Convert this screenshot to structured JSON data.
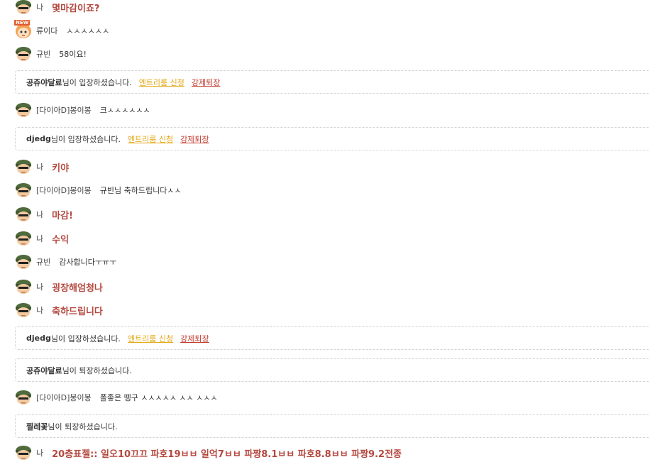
{
  "messages": [
    {
      "type": "chat",
      "me": true,
      "avatar": "soldier",
      "nick": "나",
      "text": "몇마감이죠?"
    },
    {
      "type": "chat",
      "me": false,
      "avatar": "new-character",
      "nick": "류이다",
      "text": "ㅅㅅㅅㅅㅅㅅ",
      "badge": "NEW"
    },
    {
      "type": "chat",
      "me": false,
      "avatar": "soldier",
      "nick": "규빈",
      "text": "58이요!"
    },
    {
      "type": "system",
      "user": "공쥬야달료",
      "suffix": "님이 입장하셨습니다.",
      "entry": "엔트리룸 신청",
      "kick": "강제퇴장"
    },
    {
      "type": "chat",
      "me": false,
      "avatar": "soldier",
      "nick": "[다이아D]봉이봉",
      "text": "크ㅅㅅㅅㅅㅅㅅ"
    },
    {
      "type": "system",
      "user": "djedg",
      "suffix": "님이 입장하셨습니다.",
      "entry": "엔트리룸 신청",
      "kick": "강제퇴장"
    },
    {
      "type": "chat",
      "me": true,
      "avatar": "soldier",
      "nick": "나",
      "text": "키야"
    },
    {
      "type": "chat",
      "me": false,
      "avatar": "soldier",
      "nick": "[다이아D]봉이봉",
      "text": "규빈님 축하드립니다ㅅㅅ"
    },
    {
      "type": "chat",
      "me": true,
      "avatar": "soldier",
      "nick": "나",
      "text": "마감!"
    },
    {
      "type": "chat",
      "me": true,
      "avatar": "soldier",
      "nick": "나",
      "text": "수익"
    },
    {
      "type": "chat",
      "me": false,
      "avatar": "soldier",
      "nick": "규빈",
      "text": "감사합니다ㅜㅠㅜ"
    },
    {
      "type": "chat",
      "me": true,
      "avatar": "soldier",
      "nick": "나",
      "text": "굉장해엄청나"
    },
    {
      "type": "chat",
      "me": true,
      "avatar": "soldier",
      "nick": "나",
      "text": "축하드립니다"
    },
    {
      "type": "system",
      "user": "djedg",
      "suffix": "님이 입장하셨습니다.",
      "entry": "엔트리룸 신청",
      "kick": "강제퇴장"
    },
    {
      "type": "system",
      "user": "공쥬야달료",
      "suffix": "님이 퇴장하셨습니다."
    },
    {
      "type": "chat",
      "me": false,
      "avatar": "soldier",
      "nick": "[다이아D]봉이봉",
      "text": "폴좋은 뗑구 ㅅㅅㅅㅅㅅ ㅅㅅ ㅅㅅㅅ"
    },
    {
      "type": "system",
      "user": "찔레꽃",
      "suffix": "님이 퇴장하셨습니다."
    },
    {
      "type": "chat",
      "me": true,
      "avatar": "soldier",
      "nick": "나",
      "text": "20층표젤:: 일오10끄끄 파호19ㅂㅂ 일억7ㅂㅂ 파짱8.1ㅂㅂ 파호8.8ㅂㅂ 파짱9.2전종"
    }
  ]
}
